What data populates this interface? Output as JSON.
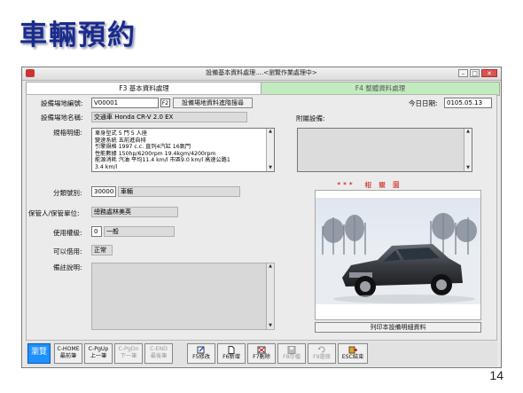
{
  "slide": {
    "title": "車輛預約",
    "page_number": "14"
  },
  "window": {
    "title": "設備基本資料處理....<瀏覽作業處理中>"
  },
  "tabs": [
    {
      "label": "F3 基本資料處理",
      "active": true
    },
    {
      "label": "F4 整體資料處理",
      "active": false
    }
  ],
  "form": {
    "venue_code_label": "設備場地編號:",
    "venue_code_value": "V00001",
    "f2_label": "F2",
    "lookup_button": "設備場地資料進階搜尋",
    "date_label": "今日日期:",
    "date_value": "0105.05.13",
    "venue_name_label": "設備場地名稱:",
    "venue_name_value": "交通車 Honda CR-V 2.0 EX",
    "attached_label": "附屬設備:",
    "spec_label": "規格明細:",
    "spec_value": "車身型式 5 門 5 人座\n變速系統 五前進自排\n引擎規格 1997 c.c. 直列4汽缸 16氣門\n性能數據 150hp/6200rpm 19.4kgm/4200rpm\n能源消耗 汽油 平均11.4 km/l 市區9.0 km/l 高速公路1\n3.4 km/l",
    "category_label": "分類號別:",
    "category_code": "30000",
    "category_name": "車輛",
    "custodian_label": "保管人/保管單位:",
    "custodian_value": "總務處林美英",
    "usage_label": "使用權級:",
    "usage_code": "0",
    "usage_name": "一般",
    "borrowable_label": "可以借用:",
    "borrowable_value": "正常",
    "remarks_label": "備註說明:",
    "photo_title": "相 關 圖 片",
    "photo_stars": "***",
    "print_button": "列印本設備明細資料"
  },
  "toolbar": [
    {
      "line1": "瀏覽",
      "line2": "",
      "enabled": true,
      "icon": "browse-mode"
    },
    {
      "line1": "C-HOME",
      "line2": "最前筆",
      "enabled": true,
      "icon": "first-record"
    },
    {
      "line1": "C-PgUp",
      "line2": "上一筆",
      "enabled": true,
      "icon": "previous-record"
    },
    {
      "line1": "C-PgDn",
      "line2": "下一筆",
      "enabled": false,
      "icon": "next-record"
    },
    {
      "line1": "C-END",
      "line2": "最後筆",
      "enabled": false,
      "icon": "last-record"
    },
    {
      "line1": "",
      "line2": "F5修改",
      "enabled": true,
      "icon": "edit-icon"
    },
    {
      "line1": "",
      "line2": "F6新增",
      "enabled": true,
      "icon": "new-doc-icon"
    },
    {
      "line1": "",
      "line2": "F7刪除",
      "enabled": true,
      "icon": "delete-icon"
    },
    {
      "line1": "",
      "line2": "F8存檔",
      "enabled": false,
      "icon": "save-icon"
    },
    {
      "line1": "",
      "line2": "F9還原",
      "enabled": false,
      "icon": "undo-icon"
    },
    {
      "line1": "",
      "line2": "ESC結束",
      "enabled": true,
      "icon": "exit-icon"
    }
  ],
  "colors": {
    "slide_title": "#1a2b8c",
    "active_tab": "#ffffff",
    "inactive_tab": "#c2ecc0",
    "stars": "#cc0000",
    "browse_button": "#1e90ff"
  }
}
